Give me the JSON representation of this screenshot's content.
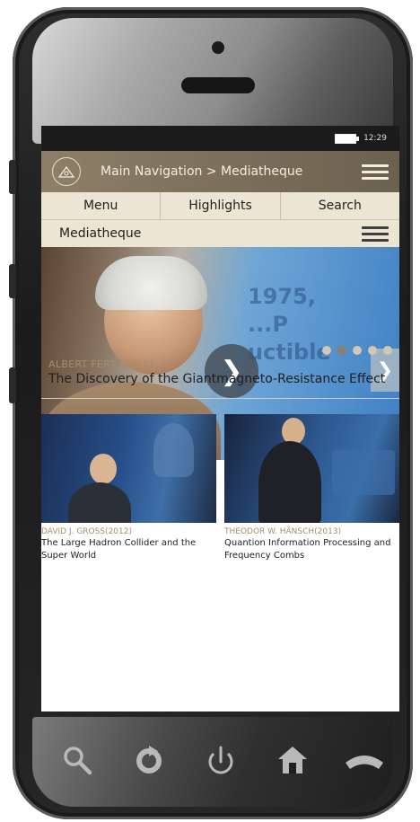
{
  "status": {
    "time": "12:29"
  },
  "nav": {
    "title": "Main Navigation > Mediatheque",
    "logo_icon": "lindau-logo-icon"
  },
  "tabs": [
    {
      "label": "Menu"
    },
    {
      "label": "Highlights"
    },
    {
      "label": "Search"
    }
  ],
  "section": {
    "title": "Mediatheque"
  },
  "hero": {
    "screen_text": "1975,\n...P\nuctible",
    "meta": "ALBERT FERT (2010)",
    "title": "The Discovery of the Giantmagneto-Resistance Effect",
    "dots": 5,
    "active_dot": 1
  },
  "cards": [
    {
      "meta": "DAVID J. GROSS(2012)",
      "title": "The Large Hadron Collider and the Super World"
    },
    {
      "meta": "THEODOR W. HÄNSCH(2013)",
      "title": "Quantion Information Processing and Frequency Combs"
    }
  ],
  "softkeys": [
    {
      "name": "search-icon",
      "glyph": "⚲"
    },
    {
      "name": "refresh-icon",
      "glyph": "↻"
    },
    {
      "name": "power-icon",
      "glyph": "⏻"
    },
    {
      "name": "home-icon",
      "glyph": "⌂"
    },
    {
      "name": "hangup-icon",
      "glyph": "☎"
    }
  ],
  "colors": {
    "nav_bar": "#7b6f5b",
    "tab_bar": "#ece5d3",
    "meta_text": "#a68d6c",
    "dot_active": "#8c806c",
    "dot_inactive": "#d2c7b1"
  }
}
